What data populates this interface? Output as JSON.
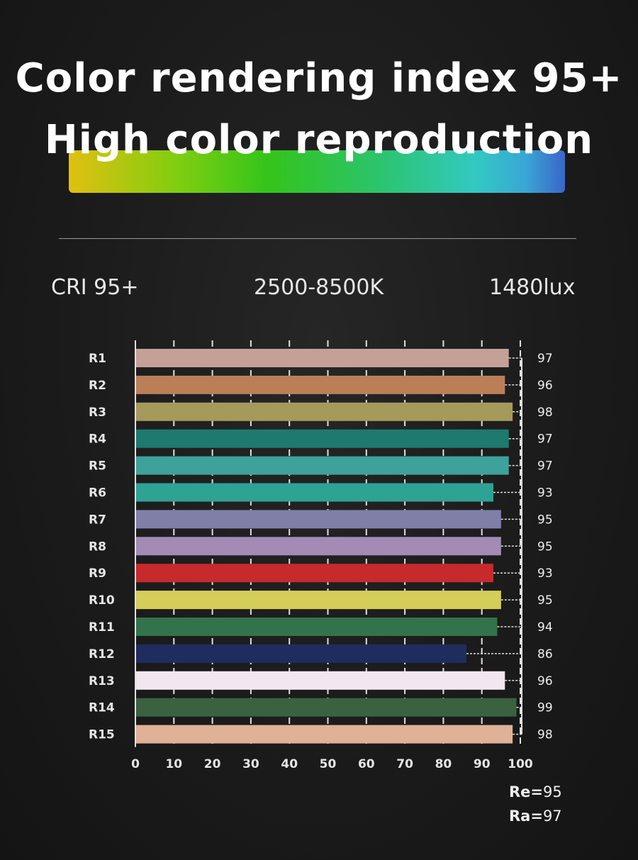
{
  "headline": {
    "line1": "Color rendering index 95+",
    "line2": "High color reproduction"
  },
  "specs": {
    "cri": "CRI 95+",
    "cct": "2500-8500K",
    "lux": "1480lux"
  },
  "summary": {
    "re_label": "Re=",
    "re_value": "95",
    "ra_label": "Ra=",
    "ra_value": "97"
  },
  "colors": {
    "gradient": [
      "#e0c010",
      "#34c41a",
      "#32c9c2",
      "#3a66c8"
    ],
    "background": "#1b1b1b"
  },
  "chart_data": {
    "type": "bar",
    "orientation": "horizontal",
    "categories": [
      "R1",
      "R2",
      "R3",
      "R4",
      "R5",
      "R6",
      "R7",
      "R8",
      "R9",
      "R10",
      "R11",
      "R12",
      "R13",
      "R14",
      "R15"
    ],
    "values": [
      97,
      96,
      98,
      97,
      97,
      93,
      95,
      95,
      93,
      95,
      94,
      86,
      96,
      99,
      98
    ],
    "bar_colors": [
      "#c3a197",
      "#bb7f58",
      "#a59a5c",
      "#1e7a6e",
      "#3ea19a",
      "#2ea293",
      "#7f7faa",
      "#a38bb5",
      "#c72a2c",
      "#d4cd5a",
      "#33734a",
      "#1f2d5e",
      "#f2e7f0",
      "#3a6140",
      "#dfb196"
    ],
    "xticks": [
      0,
      10,
      20,
      30,
      40,
      50,
      60,
      70,
      80,
      90,
      100
    ],
    "xlim": [
      0,
      100
    ],
    "grid": true
  }
}
